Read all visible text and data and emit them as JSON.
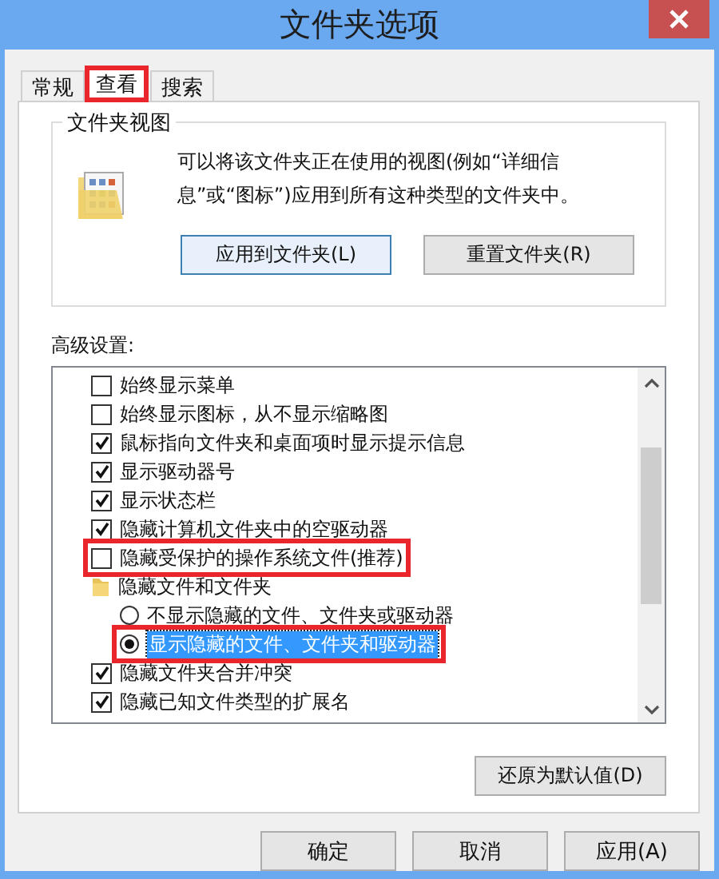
{
  "window": {
    "title": "文件夹选项"
  },
  "tabs": [
    {
      "label": "常规",
      "selected": false,
      "highlighted": false
    },
    {
      "label": "查看",
      "selected": true,
      "highlighted": true
    },
    {
      "label": "搜索",
      "selected": false,
      "highlighted": false
    }
  ],
  "folder_views": {
    "title": "文件夹视图",
    "description": "可以将该文件夹正在使用的视图(例如“详细信息”或“图标”)应用到所有这种类型的文件夹中。",
    "buttons": [
      "应用到文件夹(L)",
      "重置文件夹(R)"
    ]
  },
  "advanced": {
    "label": "高级设置:",
    "items": [
      {
        "kind": "checkbox",
        "label": "始终显示菜单",
        "checked": false,
        "highlighted": false
      },
      {
        "kind": "checkbox",
        "label": "始终显示图标，从不显示缩略图",
        "checked": false,
        "highlighted": false
      },
      {
        "kind": "checkbox",
        "label": "鼠标指向文件夹和桌面项时显示提示信息",
        "checked": true,
        "highlighted": false
      },
      {
        "kind": "checkbox",
        "label": "显示驱动器号",
        "checked": true,
        "highlighted": false
      },
      {
        "kind": "checkbox",
        "label": "显示状态栏",
        "checked": true,
        "highlighted": false
      },
      {
        "kind": "checkbox",
        "label": "隐藏计算机文件夹中的空驱动器",
        "checked": true,
        "highlighted": false
      },
      {
        "kind": "checkbox",
        "label": "隐藏受保护的操作系统文件(推荐)",
        "checked": false,
        "highlighted": true
      },
      {
        "kind": "group",
        "label": "隐藏文件和文件夹",
        "children": [
          {
            "kind": "radio",
            "label": "不显示隐藏的文件、文件夹或驱动器",
            "selected": false,
            "highlighted": false
          },
          {
            "kind": "radio",
            "label": "显示隐藏的文件、文件夹和驱动器",
            "selected": true,
            "highlighted": true
          }
        ]
      },
      {
        "kind": "checkbox",
        "label": "隐藏文件夹合并冲突",
        "checked": true,
        "highlighted": false
      },
      {
        "kind": "checkbox",
        "label": "隐藏已知文件类型的扩展名",
        "checked": true,
        "highlighted": false
      }
    ],
    "restore_button": "还原为默认值(D)"
  },
  "buttons": [
    "确定",
    "取消",
    "应用(A)"
  ]
}
